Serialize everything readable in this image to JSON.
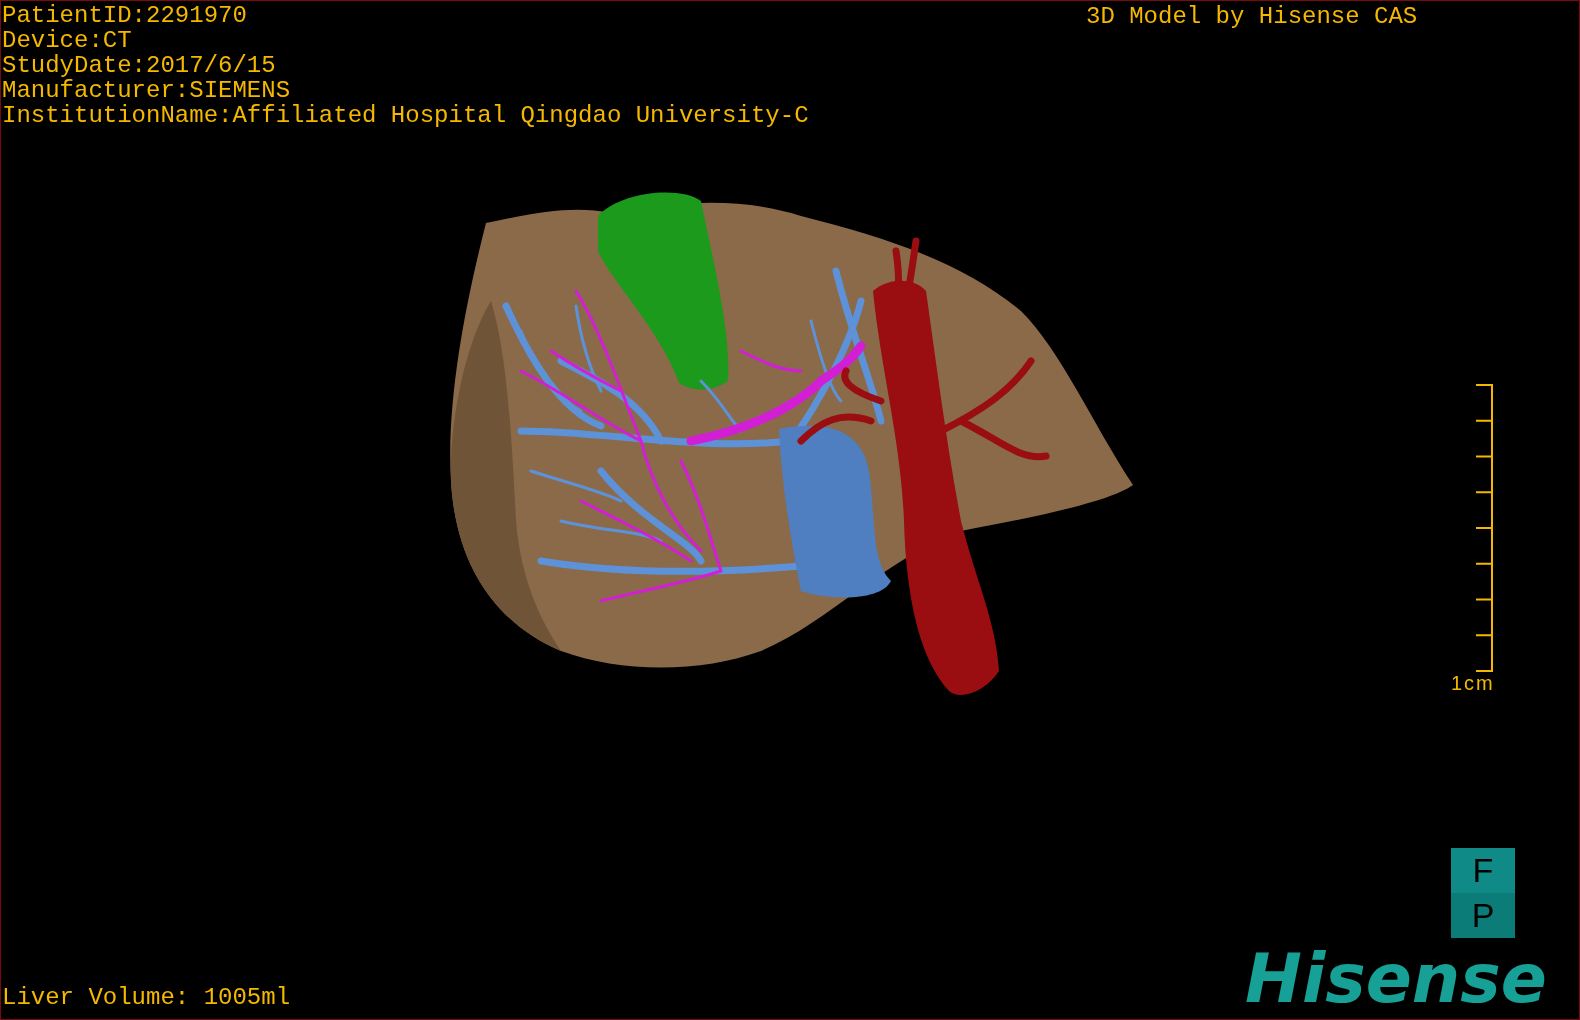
{
  "patient_info": [
    "PatientID:2291970",
    "Device:CT",
    "StudyDate:2017/6/15",
    "Manufacturer:SIEMENS",
    "InstitutionName:Affiliated Hospital Qingdao University-C"
  ],
  "caption": "3D Model by Hisense CAS",
  "scale_bar": {
    "label": "1cm"
  },
  "view_buttons": [
    {
      "label": "F"
    },
    {
      "label": "P"
    }
  ],
  "liver_volume": "Liver Volume: 1005ml",
  "logo": "Hisense"
}
